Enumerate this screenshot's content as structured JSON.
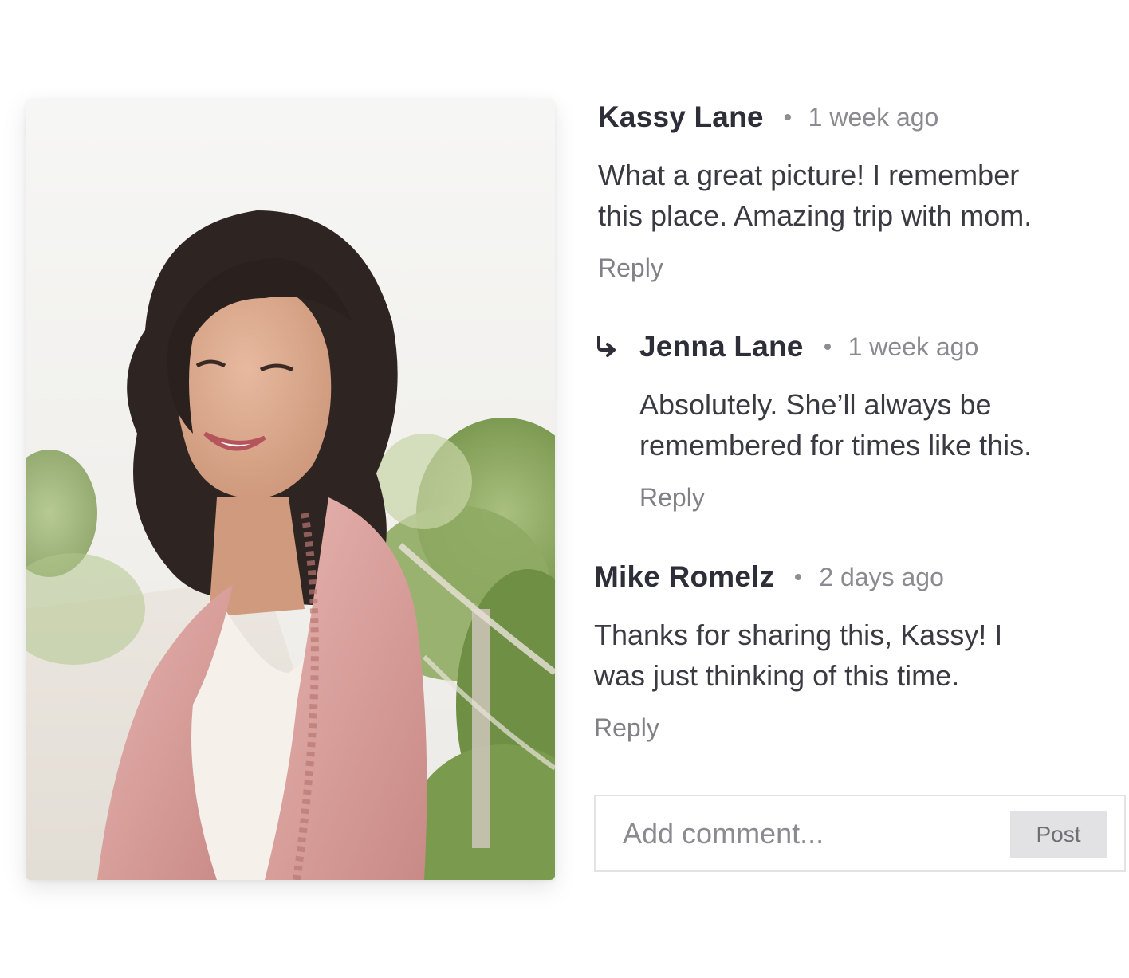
{
  "photo": {
    "icon": "portrait-photo"
  },
  "comments": [
    {
      "author": "Kassy Lane",
      "time": "1 week ago",
      "lines": [
        "What a great picture! I remember",
        "this place. Amazing trip with mom."
      ],
      "reply_label": "Reply"
    },
    {
      "author": "Jenna Lane",
      "time": "1 week ago",
      "lines": [
        "Absolutely. She’ll always be",
        "remembered for times like this."
      ],
      "reply_label": "Reply",
      "icon": "reply-arrow-icon"
    },
    {
      "author": "Mike Romelz",
      "time": "2 days ago",
      "lines": [
        "Thanks for sharing this, Kassy! I",
        "was just thinking of this time."
      ],
      "reply_label": "Reply"
    }
  ],
  "composer": {
    "placeholder": "Add comment...",
    "post_label": "Post"
  },
  "colors": {
    "author": "#2e2e38",
    "muted": "#8a8a90",
    "button_bg": "#e2e2e4",
    "cardigan": "#d9a3a1"
  }
}
